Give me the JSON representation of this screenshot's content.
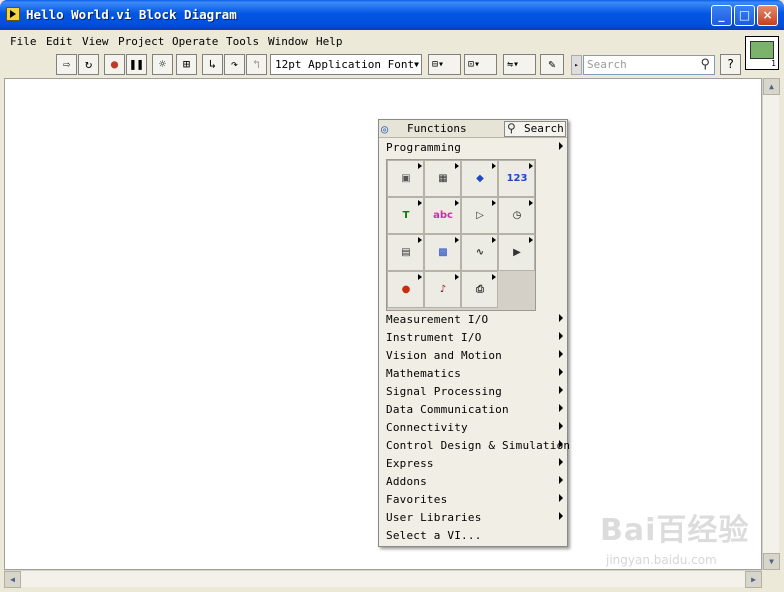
{
  "window": {
    "title": "Hello World.vi Block Diagram",
    "buttons": {
      "minimize": "_",
      "maximize": "□",
      "close": "×"
    }
  },
  "menu": [
    "File",
    "Edit",
    "View",
    "Project",
    "Operate",
    "Tools",
    "Window",
    "Help"
  ],
  "toolbar": {
    "font_select": "12pt Application Font",
    "search_placeholder": "Search",
    "help_label": "?",
    "vi_connector_number": "1"
  },
  "palette": {
    "title": "Functions",
    "search_label": "Search",
    "first_category": "Programming",
    "categories": [
      "Measurement I/O",
      "Instrument I/O",
      "Vision and Motion",
      "Mathematics",
      "Signal Processing",
      "Data Communication",
      "Connectivity",
      "Control Design & Simulation",
      "Express",
      "Addons",
      "Favorites",
      "User Libraries",
      "Select a VI..."
    ],
    "icons": [
      {
        "name": "structures-icon",
        "glyph": "▣",
        "color": "#555555"
      },
      {
        "name": "array-icon",
        "glyph": "▦",
        "color": "#333333"
      },
      {
        "name": "cluster-icon",
        "glyph": "◆",
        "color": "#1f47c8"
      },
      {
        "name": "numeric-icon",
        "glyph": "123",
        "color": "#1f47c8"
      },
      {
        "name": "boolean-icon",
        "glyph": "T",
        "color": "#117a11"
      },
      {
        "name": "string-icon",
        "glyph": "abc",
        "color": "#cc2fa5"
      },
      {
        "name": "comparison-icon",
        "glyph": "▷",
        "color": "#333333"
      },
      {
        "name": "timing-icon",
        "glyph": "◷",
        "color": "#111111"
      },
      {
        "name": "dialog-icon",
        "glyph": "▤",
        "color": "#333333"
      },
      {
        "name": "file-io-icon",
        "glyph": "▩",
        "color": "#1f47c8"
      },
      {
        "name": "waveform-icon",
        "glyph": "∿",
        "color": "#333333"
      },
      {
        "name": "app-control-icon",
        "glyph": "▶",
        "color": "#333333"
      },
      {
        "name": "synchronization-icon",
        "glyph": "●",
        "color": "#cc2a0d"
      },
      {
        "name": "graphics-sound-icon",
        "glyph": "♪",
        "color": "#8b0f0f"
      },
      {
        "name": "report-generation-icon",
        "glyph": "⎙",
        "color": "#333333"
      }
    ]
  },
  "watermark": {
    "brand": "Bai百经验",
    "url": "jingyan.baidu.com"
  }
}
